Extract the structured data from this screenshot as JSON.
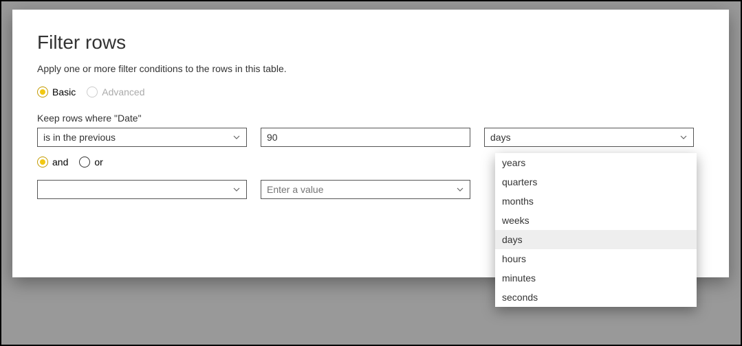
{
  "dialog": {
    "title": "Filter rows",
    "subtitle": "Apply one or more filter conditions to the rows in this table."
  },
  "mode": {
    "basic": "Basic",
    "advanced": "Advanced"
  },
  "keep_label": "Keep rows where \"Date\"",
  "row1": {
    "operator": "is in the previous",
    "value": "90",
    "unit_selected": "days"
  },
  "logic": {
    "and": "and",
    "or": "or"
  },
  "row2": {
    "operator": "",
    "value_placeholder": "Enter a value"
  },
  "unit_options": [
    "years",
    "quarters",
    "months",
    "weeks",
    "days",
    "hours",
    "minutes",
    "seconds"
  ],
  "unit_active": "days"
}
